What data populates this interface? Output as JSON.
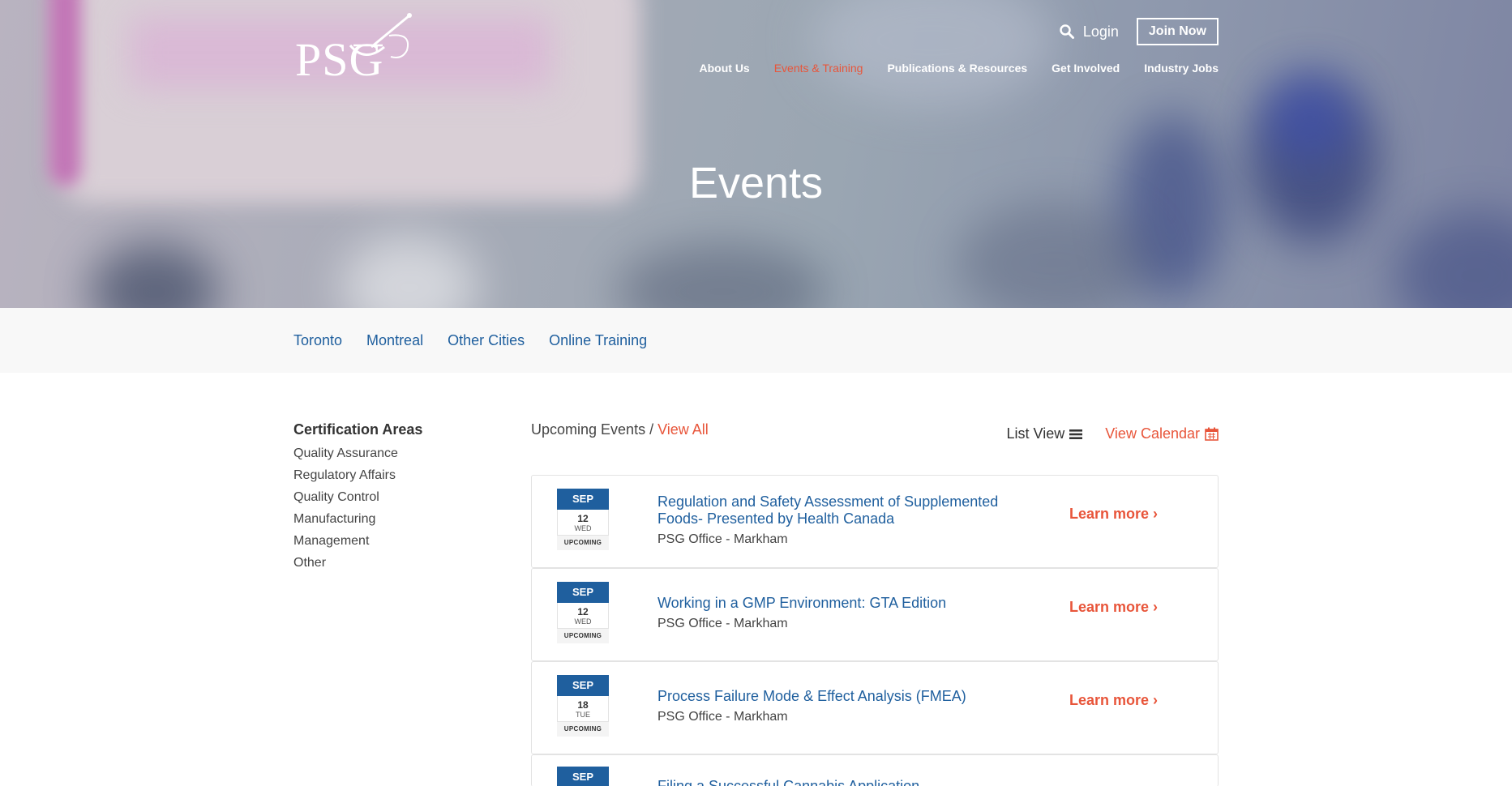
{
  "header": {
    "logo_text": "PSG",
    "login_label": "Login",
    "join_label": "Join Now",
    "nav": [
      {
        "label": "About Us",
        "active": false
      },
      {
        "label": "Events & Training",
        "active": true
      },
      {
        "label": "Publications & Resources",
        "active": false
      },
      {
        "label": "Get Involved",
        "active": false
      },
      {
        "label": "Industry Jobs",
        "active": false
      }
    ]
  },
  "hero": {
    "title": "Events"
  },
  "subnav": [
    "Toronto",
    "Montreal",
    "Other Cities",
    "Online Training"
  ],
  "sidebar": {
    "heading": "Certification Areas",
    "items": [
      "Quality Assurance",
      "Regulatory Affairs",
      "Quality Control",
      "Manufacturing",
      "Management",
      "Other"
    ]
  },
  "events_header": {
    "label": "Upcoming Events / ",
    "view_all": "View All",
    "list_view": "List View",
    "view_calendar": "View Calendar"
  },
  "events": [
    {
      "month": "SEP",
      "day": "12",
      "weekday": "WED",
      "status": "UPCOMING",
      "title": "Regulation and Safety Assessment of Supplemented Foods- Presented by Health Canada",
      "location": "PSG Office - Markham",
      "cta": "Learn more ›"
    },
    {
      "month": "SEP",
      "day": "12",
      "weekday": "WED",
      "status": "UPCOMING",
      "title": "Working in a GMP Environment: GTA Edition",
      "location": "PSG Office - Markham",
      "cta": "Learn more ›"
    },
    {
      "month": "SEP",
      "day": "18",
      "weekday": "TUE",
      "status": "UPCOMING",
      "title": "Process Failure Mode & Effect Analysis (FMEA)",
      "location": "PSG Office - Markham",
      "cta": "Learn more ›"
    },
    {
      "month": "SEP",
      "title": "Filing a Successful Cannabis Application"
    }
  ],
  "colors": {
    "accent": "#e8553a",
    "link": "#1f5f9e",
    "date_header": "#1f5f9e"
  }
}
